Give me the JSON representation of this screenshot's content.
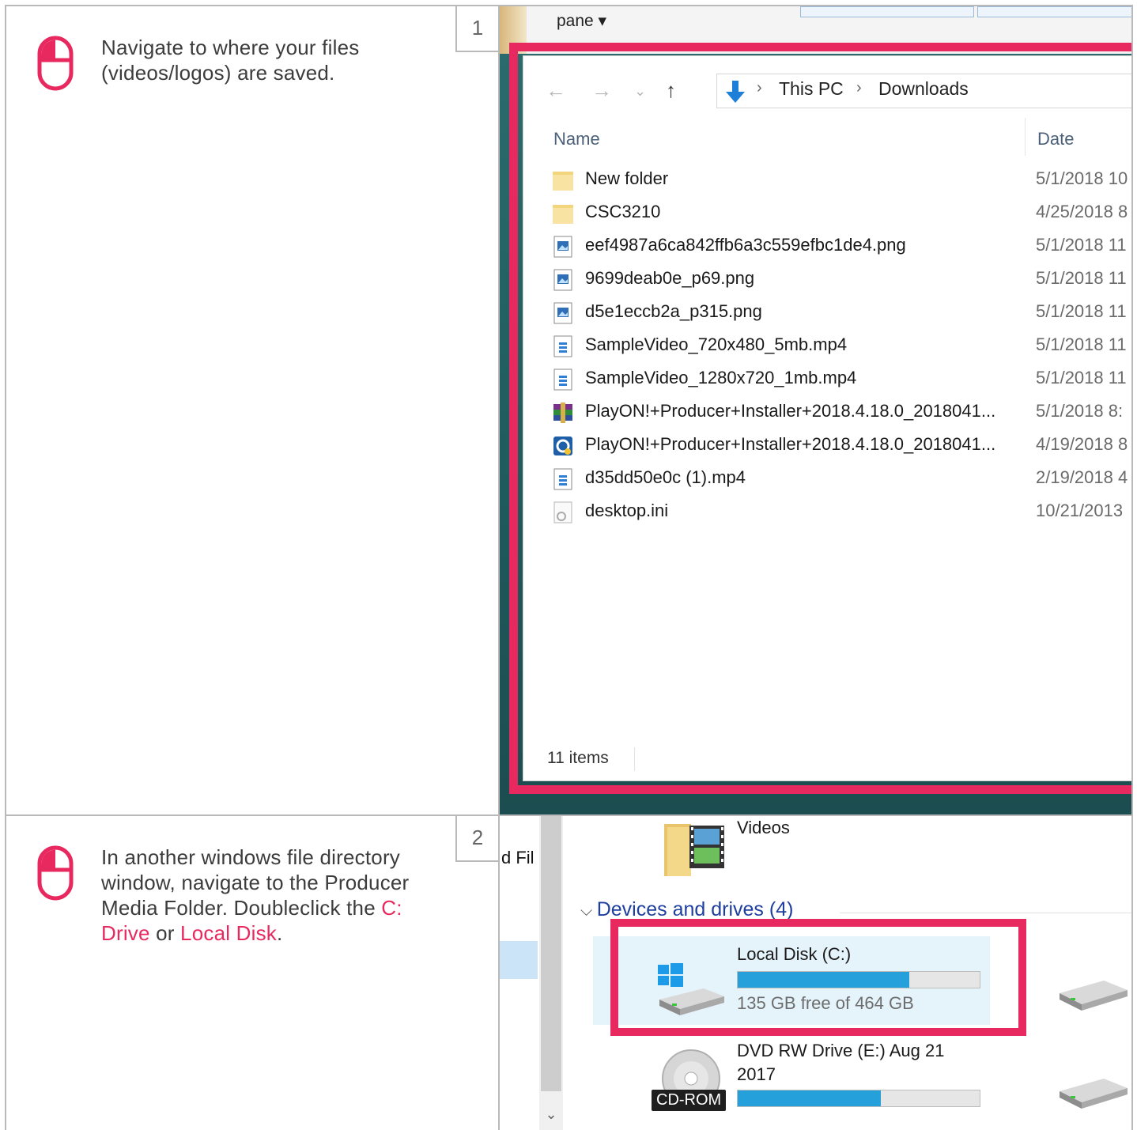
{
  "steps": [
    {
      "number": "1",
      "instruction": "Navigate to where your files (videos/logos) are saved.",
      "screenshot": {
        "top_label": "pane ▾",
        "address": {
          "segments": [
            "This PC",
            "Downloads"
          ]
        },
        "columns": {
          "name": "Name",
          "date": "Date"
        },
        "files": [
          {
            "name": "New folder",
            "date": "5/1/2018 10",
            "icon": "folder-icon"
          },
          {
            "name": "CSC3210",
            "date": "4/25/2018 8",
            "icon": "folder-icon"
          },
          {
            "name": "eef4987a6ca842ffb6a3c559efbc1de4.png",
            "date": "5/1/2018 11",
            "icon": "image-file-icon"
          },
          {
            "name": "9699deab0e_p69.png",
            "date": "5/1/2018 11",
            "icon": "image-file-icon"
          },
          {
            "name": "d5e1eccb2a_p315.png",
            "date": "5/1/2018 11",
            "icon": "image-file-icon"
          },
          {
            "name": "SampleVideo_720x480_5mb.mp4",
            "date": "5/1/2018 11",
            "icon": "video-file-icon"
          },
          {
            "name": "SampleVideo_1280x720_1mb.mp4",
            "date": "5/1/2018 11",
            "icon": "video-file-icon"
          },
          {
            "name": "PlayON!+Producer+Installer+2018.4.18.0_2018041...",
            "date": "5/1/2018 8:",
            "icon": "archive-icon"
          },
          {
            "name": "PlayON!+Producer+Installer+2018.4.18.0_2018041...",
            "date": "4/19/2018 8",
            "icon": "installer-icon"
          },
          {
            "name": "d35dd50e0c (1).mp4",
            "date": "2/19/2018 4",
            "icon": "video-file-icon"
          },
          {
            "name": "desktop.ini",
            "date": "10/21/2013",
            "icon": "settings-file-icon"
          }
        ],
        "status": "11 items"
      }
    },
    {
      "number": "2",
      "instruction_parts": {
        "before": "In another windows file directory window, navigate to the Producer Media Folder. Doubleclick the ",
        "highlight1": "C: Drive",
        "middle": " or ",
        "highlight2": "Local Disk",
        "after": "."
      },
      "screenshot": {
        "nav_cutoff_text": "d Fil",
        "videos_label": "Videos",
        "group_header": "Devices and drives (4)",
        "drives": [
          {
            "name": "Local Disk (C:)",
            "free": "135 GB free of 464 GB",
            "used_fraction": 0.71
          },
          {
            "name": "DVD RW Drive (E:) Aug 21",
            "name_line2": "2017",
            "badge": "CD-ROM",
            "used_fraction": 0.59
          }
        ]
      }
    }
  ],
  "colors": {
    "accent": "#e8295f",
    "bar_fill": "#26a0da",
    "group_header": "#1e3f9e",
    "selection": "#e5f3fb"
  }
}
